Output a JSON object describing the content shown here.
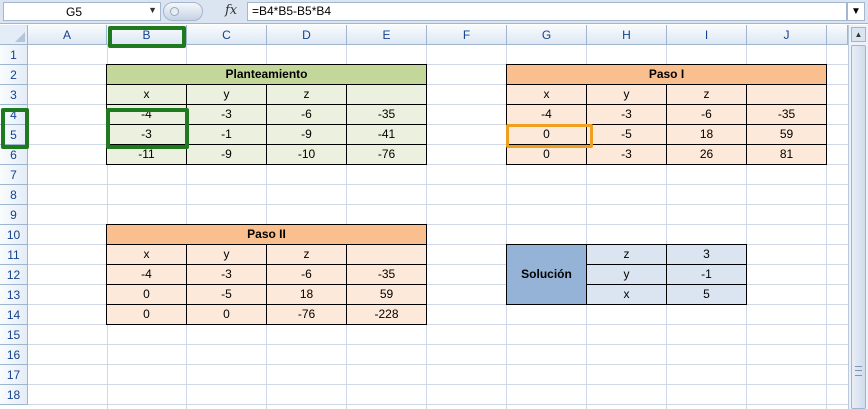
{
  "formula_bar": {
    "name_box": "G5",
    "fx_label": "fx",
    "formula": "=B4*B5-B5*B4"
  },
  "columns": [
    "A",
    "B",
    "C",
    "D",
    "E",
    "F",
    "G",
    "H",
    "I",
    "J"
  ],
  "rows": [
    "1",
    "2",
    "3",
    "4",
    "5",
    "6",
    "7",
    "8",
    "9",
    "10",
    "11",
    "12",
    "13",
    "14",
    "15",
    "16",
    "17",
    "18"
  ],
  "planteamiento": {
    "title": "Planteamiento",
    "headers": [
      "x",
      "y",
      "z",
      ""
    ],
    "rows": [
      [
        "-4",
        "-3",
        "-6",
        "-35"
      ],
      [
        "-3",
        "-1",
        "-9",
        "-41"
      ],
      [
        "-11",
        "-9",
        "-10",
        "-76"
      ]
    ]
  },
  "paso1": {
    "title": "Paso I",
    "headers": [
      "x",
      "y",
      "z",
      ""
    ],
    "rows": [
      [
        "-4",
        "-3",
        "-6",
        "-35"
      ],
      [
        "0",
        "-5",
        "18",
        "59"
      ],
      [
        "0",
        "-3",
        "26",
        "81"
      ]
    ]
  },
  "paso2": {
    "title": "Paso II",
    "headers": [
      "x",
      "y",
      "z",
      ""
    ],
    "rows": [
      [
        "-4",
        "-3",
        "-6",
        "-35"
      ],
      [
        "0",
        "-5",
        "18",
        "59"
      ],
      [
        "0",
        "0",
        "-76",
        "-228"
      ]
    ]
  },
  "solucion": {
    "label": "Solución",
    "rows": [
      {
        "var": "z",
        "value": "3"
      },
      {
        "var": "y",
        "value": "-1"
      },
      {
        "var": "x",
        "value": "5"
      }
    ]
  },
  "colors": {
    "green_header": "#c4d79b",
    "green_light": "#ebf1de",
    "orange_header": "#fabf8f",
    "orange_light": "#fde9d9",
    "blue_dark": "#95b3d7",
    "blue_light": "#dbe5f1",
    "highlight_green": "#1f7a1f",
    "highlight_orange": "#f0a020"
  }
}
